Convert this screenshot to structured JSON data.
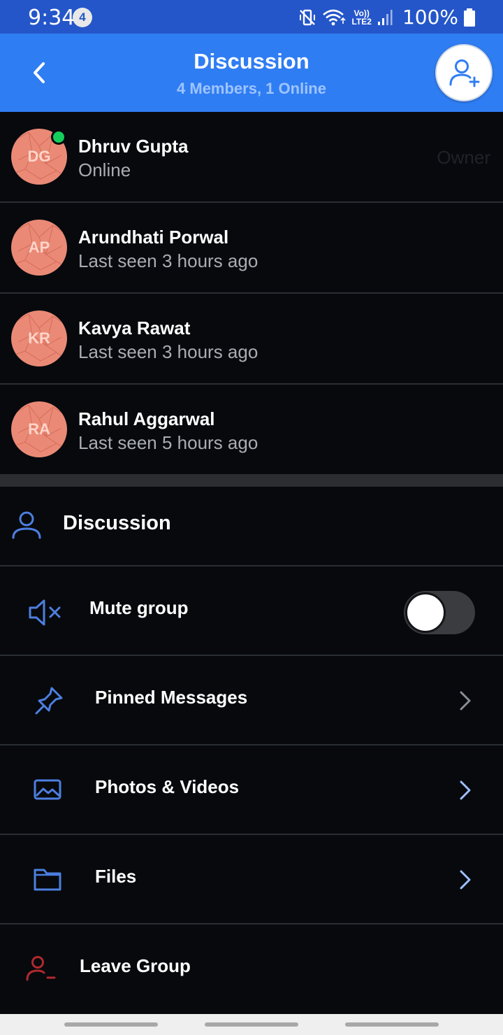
{
  "status_bar": {
    "time": "9:34",
    "notification_count": "4",
    "network_top": "Vo))",
    "network_bottom": "LTE2",
    "battery": "100%"
  },
  "header": {
    "title": "Discussion",
    "subtitle": "4 Members, 1 Online"
  },
  "members": [
    {
      "initials": "DG",
      "name": "Dhruv Gupta",
      "status": "Online",
      "role": "Owner",
      "online": true
    },
    {
      "initials": "AP",
      "name": "Arundhati Porwal",
      "status": "Last seen 3 hours ago",
      "role": "",
      "online": false
    },
    {
      "initials": "KR",
      "name": "Kavya Rawat",
      "status": "Last seen 3 hours ago",
      "role": "",
      "online": false
    },
    {
      "initials": "RA",
      "name": "Rahul Aggarwal",
      "status": "Last seen 5 hours ago",
      "role": "",
      "online": false
    }
  ],
  "group": {
    "name": "Discussion"
  },
  "settings": {
    "mute_label": "Mute group",
    "mute_enabled": false,
    "pinned_label": "Pinned Messages",
    "media_label": "Photos & Videos",
    "files_label": "Files",
    "leave_label": "Leave Group"
  },
  "colors": {
    "header_blue": "#2f7df3",
    "status_bar_blue": "#2456c9",
    "icon_blue": "#4d7fe0",
    "online_green": "#14cf5c",
    "leave_red": "#b0292d",
    "avatar_salmon": "#ea8a76"
  },
  "icons": {
    "back": "chevron-left-icon",
    "add_member": "person-add-icon",
    "group": "person-outline-icon",
    "mute": "speaker-mute-icon",
    "pinned": "pin-icon",
    "media": "image-icon",
    "files": "folder-icon",
    "leave": "person-remove-icon"
  }
}
